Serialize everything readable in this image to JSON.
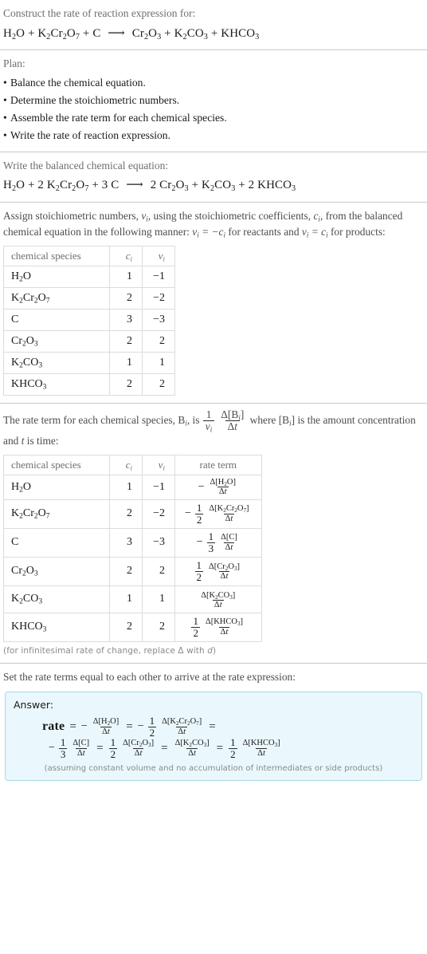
{
  "header": {
    "prompt": "Construct the rate of reaction expression for:",
    "equation_unbalanced": "H2O + K2Cr2O7 + C ⟶ Cr2O3 + K2CO3 + KHCO3"
  },
  "plan": {
    "title": "Plan:",
    "items": [
      "Balance the chemical equation.",
      "Determine the stoichiometric numbers.",
      "Assemble the rate term for each chemical species.",
      "Write the rate of reaction expression."
    ]
  },
  "balanced": {
    "prompt": "Write the balanced chemical equation:",
    "equation": "H2O + 2 K2Cr2O7 + 3 C ⟶ 2 Cr2O3 + K2CO3 + 2 KHCO3",
    "reactants": [
      {
        "coef": "",
        "formula": "H2O"
      },
      {
        "coef": "2",
        "formula": "K2Cr2O7"
      },
      {
        "coef": "3",
        "formula": "C"
      }
    ],
    "products": [
      {
        "coef": "2",
        "formula": "Cr2O3"
      },
      {
        "coef": "",
        "formula": "K2CO3"
      },
      {
        "coef": "2",
        "formula": "KHCO3"
      }
    ]
  },
  "stoich": {
    "paragraph_1": "Assign stoichiometric numbers, ",
    "paragraph_2": ", using the stoichiometric coefficients, ",
    "paragraph_3": ", from the balanced chemical equation in the following manner: ",
    "paragraph_4": " for reactants and ",
    "paragraph_5": " for products:",
    "nu_symbol": "νi",
    "c_symbol": "ci",
    "rule_reactants": "νi = −ci",
    "rule_products": "νi = ci",
    "table": {
      "headers": [
        "chemical species",
        "ci",
        "νi"
      ],
      "rows": [
        {
          "species": "H2O",
          "c": "1",
          "v": "−1"
        },
        {
          "species": "K2Cr2O7",
          "c": "2",
          "v": "−2"
        },
        {
          "species": "C",
          "c": "3",
          "v": "−3"
        },
        {
          "species": "Cr2O3",
          "c": "2",
          "v": "2"
        },
        {
          "species": "K2CO3",
          "c": "1",
          "v": "1"
        },
        {
          "species": "KHCO3",
          "c": "2",
          "v": "2"
        }
      ]
    }
  },
  "rateterm": {
    "paragraph_1": "The rate term for each chemical species, ",
    "b_symbol": "Bi",
    "paragraph_2": ", is ",
    "paragraph_3": " where ",
    "bracket_b": "[Bi]",
    "paragraph_4": " is the amount concentration and ",
    "t_symbol": "t",
    "paragraph_5": " is time:",
    "formula_num": "1",
    "formula_den": "νi",
    "formula_delta_num": "Δ[Bi]",
    "formula_delta_den": "Δt",
    "table": {
      "headers": [
        "chemical species",
        "ci",
        "νi",
        "rate term"
      ],
      "rows": [
        {
          "species": "H2O",
          "c": "1",
          "v": "−1",
          "sign": "−",
          "coef_num": "",
          "coef_den": "",
          "delta_num": "Δ[H2O]",
          "delta_den": "Δt"
        },
        {
          "species": "K2Cr2O7",
          "c": "2",
          "v": "−2",
          "sign": "−",
          "coef_num": "1",
          "coef_den": "2",
          "delta_num": "Δ[K2Cr2O7]",
          "delta_den": "Δt"
        },
        {
          "species": "C",
          "c": "3",
          "v": "−3",
          "sign": "−",
          "coef_num": "1",
          "coef_den": "3",
          "delta_num": "Δ[C]",
          "delta_den": "Δt"
        },
        {
          "species": "Cr2O3",
          "c": "2",
          "v": "2",
          "sign": "",
          "coef_num": "1",
          "coef_den": "2",
          "delta_num": "Δ[Cr2O3]",
          "delta_den": "Δt"
        },
        {
          "species": "K2CO3",
          "c": "1",
          "v": "1",
          "sign": "",
          "coef_num": "",
          "coef_den": "",
          "delta_num": "Δ[K2CO3]",
          "delta_den": "Δt"
        },
        {
          "species": "KHCO3",
          "c": "2",
          "v": "2",
          "sign": "",
          "coef_num": "1",
          "coef_den": "2",
          "delta_num": "Δ[KHCO3]",
          "delta_den": "Δt"
        }
      ]
    },
    "footnote": "(for infinitesimal rate of change, replace Δ with d)"
  },
  "final": {
    "prompt": "Set the rate terms equal to each other to arrive at the rate expression:",
    "answer_label": "Answer:",
    "rate_word": "rate",
    "terms": [
      {
        "sign": "−",
        "coef_num": "",
        "coef_den": "",
        "delta_num": "Δ[H2O]",
        "delta_den": "Δt"
      },
      {
        "sign": "−",
        "coef_num": "1",
        "coef_den": "2",
        "delta_num": "Δ[K2Cr2O7]",
        "delta_den": "Δt"
      },
      {
        "sign": "−",
        "coef_num": "1",
        "coef_den": "3",
        "delta_num": "Δ[C]",
        "delta_den": "Δt"
      },
      {
        "sign": "",
        "coef_num": "1",
        "coef_den": "2",
        "delta_num": "Δ[Cr2O3]",
        "delta_den": "Δt"
      },
      {
        "sign": "",
        "coef_num": "",
        "coef_den": "",
        "delta_num": "Δ[K2CO3]",
        "delta_den": "Δt"
      },
      {
        "sign": "",
        "coef_num": "1",
        "coef_den": "2",
        "delta_num": "Δ[KHCO3]",
        "delta_den": "Δt"
      }
    ],
    "equals": "=",
    "assumption": "(assuming constant volume and no accumulation of intermediates or side products)"
  },
  "colors": {
    "answer_bg": "#eaf7fc",
    "answer_border": "#a8d9e8",
    "rule": "#c8c8c8",
    "muted_text": "#6e6e6e",
    "table_border": "#dcdcdc"
  }
}
